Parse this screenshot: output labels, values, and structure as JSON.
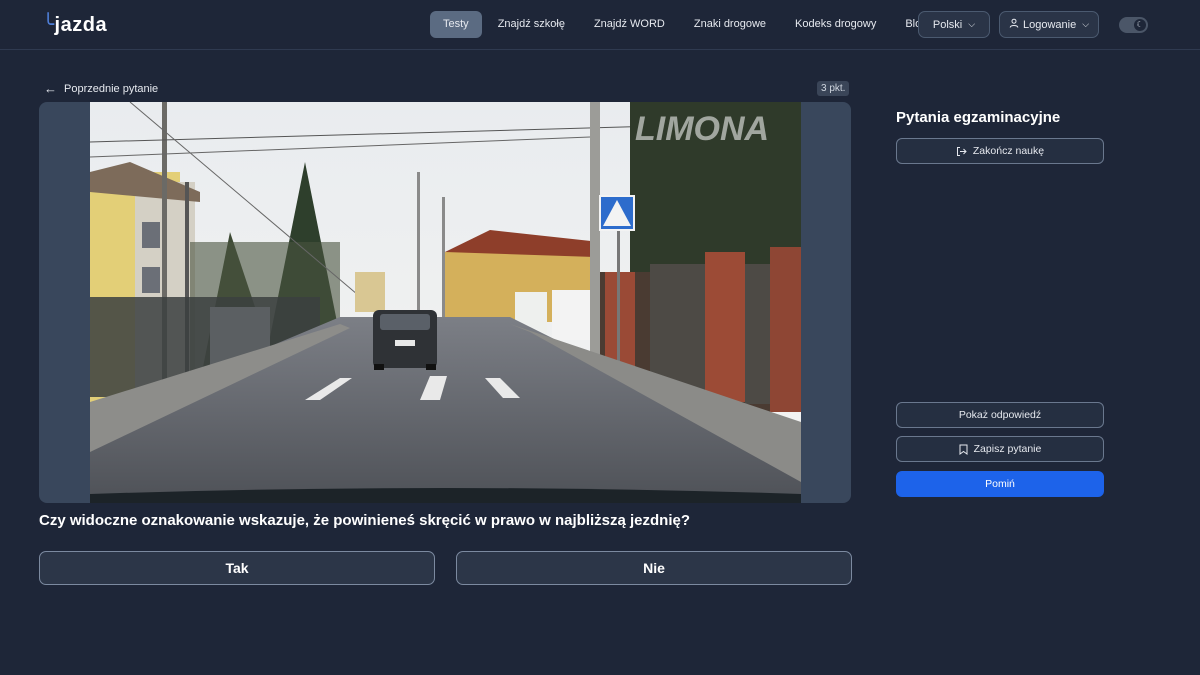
{
  "header": {
    "logo": "jazda",
    "nav": [
      {
        "label": "Testy",
        "active": true
      },
      {
        "label": "Znajdź szkołę",
        "active": false
      },
      {
        "label": "Znajdź WORD",
        "active": false
      },
      {
        "label": "Znaki drogowe",
        "active": false
      },
      {
        "label": "Kodeks drogowy",
        "active": false
      },
      {
        "label": "Blog",
        "active": false
      }
    ],
    "language": "Polski",
    "login": "Logowanie",
    "theme_icon": "moon-icon"
  },
  "question": {
    "back_label": "Poprzednie pytanie",
    "points": "3 pkt.",
    "image_watermark": "LIMONA",
    "text": "Czy widoczne oznakowanie wskazuje, że powinieneś skręcić w prawo w najbliższą jezdnię?",
    "answers": [
      "Tak",
      "Nie"
    ]
  },
  "sidebar": {
    "title": "Pytania egzaminacyjne",
    "end_label": "Zakończ naukę",
    "show_label": "Pokaż odpowiedź",
    "save_label": "Zapisz pytanie",
    "skip_label": "Pomiń"
  },
  "colors": {
    "background": "#1e2638",
    "accent": "#1d63ea",
    "active_nav": "#5b6b82"
  }
}
